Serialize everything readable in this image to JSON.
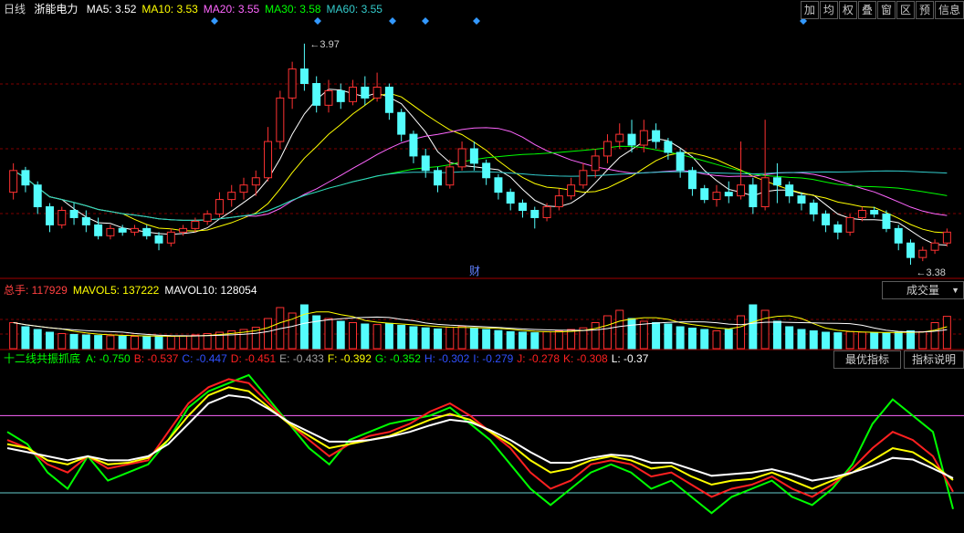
{
  "header": {
    "period": "日线",
    "stock": "浙能电力",
    "ma": [
      {
        "label": "MA5:",
        "value": "3.52",
        "color": "#ffffff"
      },
      {
        "label": "MA10:",
        "value": "3.53",
        "color": "#ffff00"
      },
      {
        "label": "MA20:",
        "value": "3.55",
        "color": "#ff66ff"
      },
      {
        "label": "MA30:",
        "value": "3.58",
        "color": "#00ff00"
      },
      {
        "label": "MA60:",
        "value": "3.55",
        "color": "#33cccc"
      }
    ]
  },
  "toolbar": [
    "加",
    "均",
    "权",
    "叠",
    "窗",
    "区",
    "预",
    "信息"
  ],
  "price_panel": {
    "high_label": "3.97",
    "low_label": "3.38",
    "marker": "财"
  },
  "volume_panel": {
    "items": [
      {
        "label": "总手:",
        "value": "117929",
        "color": "#ff4040"
      },
      {
        "label": "MAVOL5:",
        "value": "137222",
        "color": "#ffff00"
      },
      {
        "label": "MAVOL10:",
        "value": "128054",
        "color": "#ffffff"
      }
    ],
    "select_label": "成交量"
  },
  "indicator_panel": {
    "name": "十二线共振抓底",
    "items": [
      {
        "label": "A:",
        "value": "-0.750",
        "color": "#00ff00"
      },
      {
        "label": "B:",
        "value": "-0.537",
        "color": "#ff2020"
      },
      {
        "label": "C:",
        "value": "-0.447",
        "color": "#3050ff"
      },
      {
        "label": "D:",
        "value": "-0.451",
        "color": "#ff2020"
      },
      {
        "label": "E:",
        "value": "-0.433",
        "color": "#a0a0a0"
      },
      {
        "label": "F:",
        "value": "-0.392",
        "color": "#ffff00"
      },
      {
        "label": "G:",
        "value": "-0.352",
        "color": "#00ff00"
      },
      {
        "label": "H:",
        "value": "-0.302",
        "color": "#3050ff"
      },
      {
        "label": "I:",
        "value": "-0.279",
        "color": "#3050ff"
      },
      {
        "label": "J:",
        "value": "-0.278",
        "color": "#ff2020"
      },
      {
        "label": "K:",
        "value": "-0.308",
        "color": "#ff2020"
      },
      {
        "label": "L:",
        "value": "-0.37",
        "color": "#ffffff"
      }
    ],
    "buttons": [
      "最优指标",
      "指标说明"
    ]
  },
  "chart_data": {
    "type": "candlestick",
    "colors": {
      "up": "#ff3232",
      "down": "#54fcfc",
      "grid": "#800000",
      "ma5": "#ffffff",
      "ma10": "#ffff00",
      "ma20": "#ff66ff",
      "ma30": "#00ff00",
      "ma60": "#33cccc",
      "level_high": "#ff66ff",
      "level_low": "#66cccc"
    },
    "price_range": [
      3.33,
      4.04
    ],
    "candles": [
      [
        3.56,
        3.62,
        3.54,
        3.64
      ],
      [
        3.62,
        3.58,
        3.56,
        3.63
      ],
      [
        3.58,
        3.52,
        3.5,
        3.59
      ],
      [
        3.52,
        3.47,
        3.45,
        3.53
      ],
      [
        3.47,
        3.51,
        3.46,
        3.52
      ],
      [
        3.51,
        3.49,
        3.47,
        3.53
      ],
      [
        3.49,
        3.47,
        3.45,
        3.51
      ],
      [
        3.47,
        3.44,
        3.43,
        3.49
      ],
      [
        3.44,
        3.46,
        3.43,
        3.47
      ],
      [
        3.46,
        3.45,
        3.44,
        3.47
      ],
      [
        3.45,
        3.46,
        3.44,
        3.47
      ],
      [
        3.46,
        3.44,
        3.43,
        3.47
      ],
      [
        3.44,
        3.42,
        3.4,
        3.45
      ],
      [
        3.42,
        3.45,
        3.41,
        3.46
      ],
      [
        3.45,
        3.46,
        3.44,
        3.47
      ],
      [
        3.46,
        3.48,
        3.45,
        3.49
      ],
      [
        3.48,
        3.5,
        3.47,
        3.51
      ],
      [
        3.5,
        3.54,
        3.49,
        3.56
      ],
      [
        3.54,
        3.56,
        3.52,
        3.58
      ],
      [
        3.56,
        3.58,
        3.54,
        3.6
      ],
      [
        3.58,
        3.6,
        3.55,
        3.62
      ],
      [
        3.6,
        3.7,
        3.59,
        3.74
      ],
      [
        3.7,
        3.82,
        3.68,
        3.84
      ],
      [
        3.82,
        3.9,
        3.79,
        3.92
      ],
      [
        3.9,
        3.86,
        3.84,
        3.97
      ],
      [
        3.86,
        3.8,
        3.78,
        3.88
      ],
      [
        3.8,
        3.84,
        3.78,
        3.87
      ],
      [
        3.84,
        3.81,
        3.79,
        3.86
      ],
      [
        3.81,
        3.85,
        3.8,
        3.87
      ],
      [
        3.85,
        3.82,
        3.8,
        3.88
      ],
      [
        3.82,
        3.85,
        3.81,
        3.89
      ],
      [
        3.85,
        3.78,
        3.76,
        3.86
      ],
      [
        3.78,
        3.72,
        3.7,
        3.79
      ],
      [
        3.72,
        3.66,
        3.64,
        3.73
      ],
      [
        3.66,
        3.62,
        3.6,
        3.68
      ],
      [
        3.62,
        3.58,
        3.56,
        3.63
      ],
      [
        3.58,
        3.63,
        3.57,
        3.65
      ],
      [
        3.63,
        3.68,
        3.62,
        3.7
      ],
      [
        3.68,
        3.64,
        3.62,
        3.7
      ],
      [
        3.64,
        3.6,
        3.58,
        3.65
      ],
      [
        3.6,
        3.56,
        3.54,
        3.61
      ],
      [
        3.56,
        3.53,
        3.51,
        3.57
      ],
      [
        3.53,
        3.51,
        3.49,
        3.54
      ],
      [
        3.51,
        3.49,
        3.46,
        3.52
      ],
      [
        3.49,
        3.52,
        3.48,
        3.53
      ],
      [
        3.52,
        3.55,
        3.51,
        3.57
      ],
      [
        3.55,
        3.58,
        3.54,
        3.6
      ],
      [
        3.58,
        3.62,
        3.57,
        3.64
      ],
      [
        3.62,
        3.66,
        3.6,
        3.68
      ],
      [
        3.66,
        3.7,
        3.64,
        3.72
      ],
      [
        3.7,
        3.72,
        3.68,
        3.75
      ],
      [
        3.72,
        3.69,
        3.67,
        3.76
      ],
      [
        3.69,
        3.73,
        3.67,
        3.76
      ],
      [
        3.73,
        3.7,
        3.68,
        3.75
      ],
      [
        3.7,
        3.67,
        3.65,
        3.71
      ],
      [
        3.67,
        3.62,
        3.6,
        3.68
      ],
      [
        3.62,
        3.57,
        3.55,
        3.63
      ],
      [
        3.57,
        3.54,
        3.53,
        3.58
      ],
      [
        3.54,
        3.56,
        3.52,
        3.58
      ],
      [
        3.56,
        3.55,
        3.53,
        3.59
      ],
      [
        3.55,
        3.58,
        3.54,
        3.7
      ],
      [
        3.58,
        3.52,
        3.5,
        3.6
      ],
      [
        3.52,
        3.6,
        3.51,
        3.76
      ],
      [
        3.6,
        3.58,
        3.53,
        3.64
      ],
      [
        3.58,
        3.55,
        3.53,
        3.59
      ],
      [
        3.55,
        3.53,
        3.51,
        3.56
      ],
      [
        3.53,
        3.5,
        3.48,
        3.54
      ],
      [
        3.5,
        3.47,
        3.45,
        3.51
      ],
      [
        3.47,
        3.45,
        3.43,
        3.48
      ],
      [
        3.45,
        3.49,
        3.44,
        3.5
      ],
      [
        3.49,
        3.51,
        3.48,
        3.52
      ],
      [
        3.51,
        3.5,
        3.49,
        3.52
      ],
      [
        3.5,
        3.46,
        3.45,
        3.51
      ],
      [
        3.46,
        3.42,
        3.4,
        3.47
      ],
      [
        3.42,
        3.38,
        3.36,
        3.43
      ],
      [
        3.38,
        3.4,
        3.37,
        3.41
      ],
      [
        3.4,
        3.42,
        3.39,
        3.43
      ],
      [
        3.42,
        3.45,
        3.41,
        3.46
      ]
    ],
    "volume_range": [
      0,
      180000
    ],
    "volumes": [
      95000,
      80000,
      70000,
      60000,
      55000,
      52000,
      50000,
      48000,
      47000,
      46000,
      45000,
      46000,
      44000,
      45000,
      47000,
      50000,
      55000,
      60000,
      65000,
      70000,
      78000,
      110000,
      150000,
      130000,
      160000,
      120000,
      110000,
      100000,
      95000,
      90000,
      88000,
      92000,
      85000,
      80000,
      76000,
      72000,
      78000,
      82000,
      75000,
      70000,
      66000,
      62000,
      60000,
      58000,
      62000,
      65000,
      70000,
      76000,
      95000,
      120000,
      140000,
      110000,
      100000,
      95000,
      90000,
      80000,
      75000,
      70000,
      65000,
      70000,
      120000,
      160000,
      140000,
      100000,
      80000,
      70000,
      65000,
      60000,
      58000,
      62000,
      60000,
      58000,
      56000,
      60000,
      65000,
      62000,
      95000,
      117929
    ],
    "indicator_range": [
      -1.0,
      1.0
    ],
    "indicator_levels": [
      0.4,
      -0.55
    ],
    "indicator_lines": [
      {
        "name": "A",
        "color": "#00ff00",
        "values": [
          0.2,
          0.05,
          -0.3,
          -0.5,
          -0.1,
          -0.4,
          -0.3,
          -0.2,
          0.1,
          0.5,
          0.7,
          0.8,
          0.9,
          0.6,
          0.3,
          0.0,
          -0.2,
          0.1,
          0.2,
          0.3,
          0.35,
          0.4,
          0.5,
          0.3,
          0.1,
          -0.2,
          -0.5,
          -0.7,
          -0.5,
          -0.3,
          -0.2,
          -0.3,
          -0.5,
          -0.4,
          -0.6,
          -0.8,
          -0.6,
          -0.5,
          -0.4,
          -0.6,
          -0.7,
          -0.5,
          -0.2,
          0.3,
          0.6,
          0.4,
          0.2,
          -0.75
        ]
      },
      {
        "name": "B",
        "color": "#ff2020",
        "values": [
          0.1,
          0.0,
          -0.2,
          -0.3,
          -0.1,
          -0.25,
          -0.2,
          -0.15,
          0.2,
          0.55,
          0.75,
          0.85,
          0.8,
          0.55,
          0.3,
          0.1,
          -0.1,
          0.05,
          0.15,
          0.2,
          0.3,
          0.45,
          0.55,
          0.4,
          0.2,
          0.0,
          -0.3,
          -0.5,
          -0.4,
          -0.2,
          -0.15,
          -0.2,
          -0.35,
          -0.3,
          -0.45,
          -0.6,
          -0.5,
          -0.45,
          -0.35,
          -0.5,
          -0.6,
          -0.45,
          -0.25,
          0.0,
          0.2,
          0.1,
          -0.1,
          -0.537
        ]
      },
      {
        "name": "F",
        "color": "#ffff00",
        "values": [
          0.05,
          0.0,
          -0.15,
          -0.2,
          -0.1,
          -0.2,
          -0.18,
          -0.12,
          0.1,
          0.4,
          0.65,
          0.75,
          0.7,
          0.5,
          0.3,
          0.15,
          0.0,
          0.05,
          0.1,
          0.15,
          0.25,
          0.35,
          0.42,
          0.35,
          0.2,
          0.05,
          -0.15,
          -0.3,
          -0.25,
          -0.15,
          -0.1,
          -0.15,
          -0.25,
          -0.22,
          -0.35,
          -0.45,
          -0.4,
          -0.38,
          -0.3,
          -0.4,
          -0.5,
          -0.4,
          -0.3,
          -0.15,
          0.0,
          -0.05,
          -0.2,
          -0.392
        ]
      },
      {
        "name": "L",
        "color": "#ffffff",
        "values": [
          0.0,
          -0.05,
          -0.1,
          -0.15,
          -0.1,
          -0.15,
          -0.15,
          -0.1,
          0.05,
          0.3,
          0.55,
          0.65,
          0.62,
          0.48,
          0.32,
          0.2,
          0.08,
          0.08,
          0.1,
          0.14,
          0.2,
          0.28,
          0.35,
          0.32,
          0.22,
          0.1,
          -0.05,
          -0.18,
          -0.18,
          -0.12,
          -0.08,
          -0.1,
          -0.18,
          -0.18,
          -0.26,
          -0.34,
          -0.32,
          -0.3,
          -0.26,
          -0.32,
          -0.4,
          -0.36,
          -0.3,
          -0.22,
          -0.12,
          -0.14,
          -0.25,
          -0.37
        ]
      }
    ]
  }
}
